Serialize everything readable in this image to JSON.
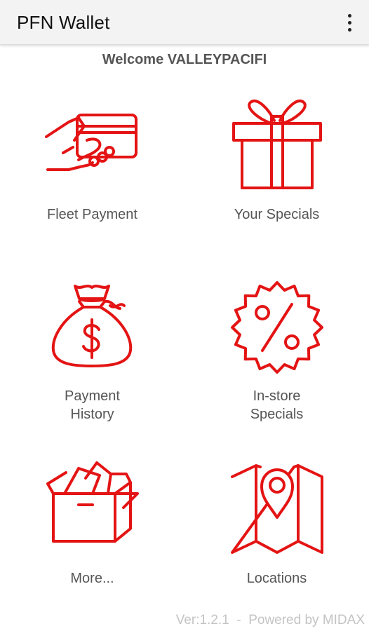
{
  "app": {
    "title": "PFN Wallet",
    "menu_icon": "overflow-menu-icon",
    "accent_color": "#e41414"
  },
  "welcome": "Welcome VALLEYPACIFI",
  "tiles": [
    {
      "icon": "card-in-hand-icon",
      "label_line1": "Fleet Payment",
      "label_line2": ""
    },
    {
      "icon": "gift-icon",
      "label_line1": "Your Specials",
      "label_line2": ""
    },
    {
      "icon": "money-bag-icon",
      "label_line1": "Payment",
      "label_line2": "History"
    },
    {
      "icon": "percent-badge-icon",
      "label_line1": "In-store",
      "label_line2": "Specials"
    },
    {
      "icon": "open-box-icon",
      "label_line1": "More...",
      "label_line2": ""
    },
    {
      "icon": "map-pin-icon",
      "label_line1": "Locations",
      "label_line2": ""
    }
  ],
  "footer": {
    "version": "Ver:1.2.1  -  Powered by MIDAX"
  }
}
